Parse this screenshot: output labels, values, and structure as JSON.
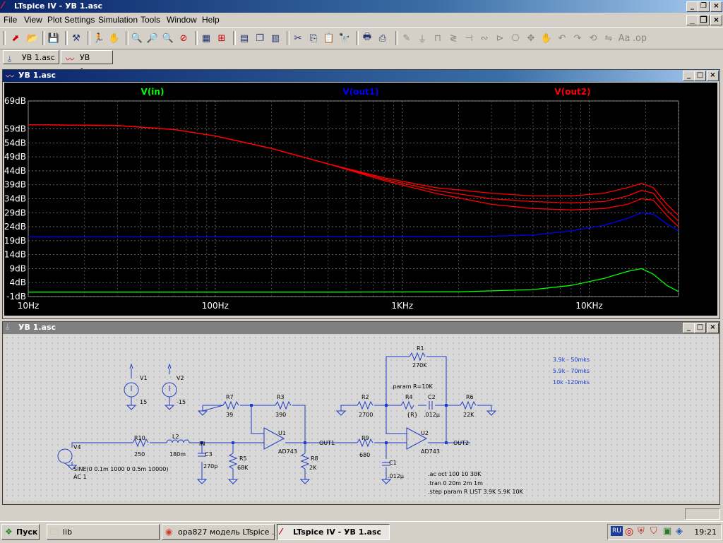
{
  "window": {
    "title": "LTspice IV - УВ 1.asc"
  },
  "menu": [
    "File",
    "View",
    "Plot Settings",
    "Simulation",
    "Tools",
    "Window",
    "Help"
  ],
  "tabs": [
    {
      "label": "УВ 1.asc",
      "icon": "schematic-icon"
    },
    {
      "label": "УВ 1.asc",
      "icon": "waveform-icon"
    }
  ],
  "plot_window": {
    "title": "УВ 1.asc"
  },
  "schematic_window": {
    "title": "УВ 1.asc"
  },
  "chart_data": {
    "type": "line",
    "x_scale": "log",
    "xlim": [
      10,
      30000
    ],
    "ylim": [
      -1,
      69
    ],
    "x_ticks": [
      {
        "v": 10,
        "label": "10Hz"
      },
      {
        "v": 100,
        "label": "100Hz"
      },
      {
        "v": 1000,
        "label": "1KHz"
      },
      {
        "v": 10000,
        "label": "10KHz"
      }
    ],
    "y_ticks": [
      {
        "v": 69,
        "label": "69dB"
      },
      {
        "v": 59,
        "label": "59dB"
      },
      {
        "v": 54,
        "label": "54dB"
      },
      {
        "v": 49,
        "label": "49dB"
      },
      {
        "v": 44,
        "label": "44dB"
      },
      {
        "v": 39,
        "label": "39dB"
      },
      {
        "v": 34,
        "label": "34dB"
      },
      {
        "v": 29,
        "label": "29dB"
      },
      {
        "v": 24,
        "label": "24dB"
      },
      {
        "v": 19,
        "label": "19dB"
      },
      {
        "v": 14,
        "label": "14dB"
      },
      {
        "v": 9,
        "label": "9dB"
      },
      {
        "v": 4,
        "label": "4dB"
      },
      {
        "v": -1,
        "label": "-1dB"
      }
    ],
    "grid": true,
    "series": [
      {
        "name": "V(in)",
        "color": "#00ff00",
        "points": [
          [
            10,
            0.6
          ],
          [
            500,
            0.6
          ],
          [
            2000,
            0.7
          ],
          [
            5000,
            1.5
          ],
          [
            8000,
            3
          ],
          [
            12000,
            5.5
          ],
          [
            16000,
            8
          ],
          [
            19000,
            9
          ],
          [
            22000,
            7
          ],
          [
            26000,
            3
          ],
          [
            30000,
            0.8
          ]
        ]
      },
      {
        "name": "V(out1)",
        "color": "#0000ff",
        "points": [
          [
            10,
            20.3
          ],
          [
            1000,
            20.4
          ],
          [
            3000,
            20.6
          ],
          [
            5000,
            21
          ],
          [
            8000,
            22.5
          ],
          [
            12000,
            24.5
          ],
          [
            16000,
            27
          ],
          [
            19000,
            29
          ],
          [
            22000,
            28.5
          ],
          [
            26000,
            25
          ],
          [
            30000,
            22.5
          ]
        ]
      },
      {
        "name": "V(out2)",
        "color": "#ff0000",
        "points": [
          [
            10,
            60.5
          ],
          [
            30,
            60.2
          ],
          [
            60,
            58.8
          ],
          [
            100,
            56.5
          ],
          [
            200,
            52
          ],
          [
            400,
            46.5
          ],
          [
            800,
            41.5
          ],
          [
            1500,
            38
          ],
          [
            3000,
            36
          ],
          [
            5000,
            35
          ],
          [
            8000,
            35
          ],
          [
            12000,
            36
          ],
          [
            16000,
            38
          ],
          [
            19000,
            39.5
          ],
          [
            22000,
            38
          ],
          [
            26000,
            32
          ],
          [
            30000,
            28
          ]
        ]
      },
      {
        "name": "V(out2)",
        "color": "#ff0000",
        "points": [
          [
            10,
            60.5
          ],
          [
            30,
            60.2
          ],
          [
            60,
            58.8
          ],
          [
            100,
            56.5
          ],
          [
            200,
            52
          ],
          [
            400,
            46.5
          ],
          [
            800,
            41
          ],
          [
            1500,
            37
          ],
          [
            3000,
            34
          ],
          [
            5000,
            33
          ],
          [
            8000,
            32.5
          ],
          [
            12000,
            33
          ],
          [
            16000,
            35
          ],
          [
            19000,
            37
          ],
          [
            22000,
            36
          ],
          [
            26000,
            30
          ],
          [
            30000,
            26
          ]
        ]
      },
      {
        "name": "V(out2)",
        "color": "#ff0000",
        "points": [
          [
            10,
            60.5
          ],
          [
            30,
            60.2
          ],
          [
            60,
            58.8
          ],
          [
            100,
            56.5
          ],
          [
            200,
            52
          ],
          [
            400,
            46.5
          ],
          [
            800,
            40.5
          ],
          [
            1500,
            36
          ],
          [
            3000,
            32
          ],
          [
            5000,
            30.5
          ],
          [
            8000,
            30
          ],
          [
            12000,
            30.5
          ],
          [
            16000,
            32
          ],
          [
            19000,
            34
          ],
          [
            22000,
            33.5
          ],
          [
            26000,
            28
          ],
          [
            30000,
            24
          ]
        ]
      }
    ],
    "legend": [
      {
        "label": "V(in)",
        "color": "#00ff00"
      },
      {
        "label": "V(out1)",
        "color": "#0000ff"
      },
      {
        "label": "V(out2)",
        "color": "#ff0000"
      }
    ]
  },
  "schematic": {
    "components": {
      "V1": {
        "name": "V1",
        "value": "15"
      },
      "V2": {
        "name": "V2",
        "value": "-15"
      },
      "V4": {
        "name": "V4",
        "value1": "SINE(0 0.1m 1000 0 0.5m 10000)",
        "value2": "AC 1"
      },
      "R10": {
        "name": "R10",
        "value": "250"
      },
      "L2": {
        "name": "L2",
        "value": "180m"
      },
      "C3": {
        "name": "C3",
        "value": "270p"
      },
      "R5": {
        "name": "R5",
        "value": "68K"
      },
      "R7": {
        "name": "R7",
        "value": "39"
      },
      "R3": {
        "name": "R3",
        "value": "390"
      },
      "U1": {
        "name": "U1",
        "value": "AD743"
      },
      "R8": {
        "name": "R8",
        "value": "2K"
      },
      "R9": {
        "name": "R9",
        "value": "680"
      },
      "C1": {
        "name": "C1",
        "value": ".012µ"
      },
      "R2": {
        "name": "R2",
        "value": "2700"
      },
      "R1": {
        "name": "R1",
        "value": "270K"
      },
      "R4": {
        "name": "R4",
        "value": "{R}"
      },
      "C2": {
        "name": "C2",
        "value": ".012µ"
      },
      "R6": {
        "name": "R6",
        "value": "22K"
      },
      "U2": {
        "name": "U2",
        "value": "AD743"
      }
    },
    "nets": {
      "in": "IN",
      "out1": "OUT1",
      "out2": "OUT2"
    },
    "directives": [
      ".ac oct 100 10 30K",
      ".tran 0 20m 2m 1m",
      ".step param R LIST 3.9K 5.9K 10K"
    ],
    "param": ".param R=10K",
    "notes": [
      "3.9k - 50mks",
      "5.9k - 70mks",
      "10k -120mks"
    ]
  },
  "taskbar": {
    "start": "Пуск",
    "tasks": [
      {
        "label": "lib",
        "icon": "folder-icon"
      },
      {
        "label": "opa827 модель LTspice ...",
        "icon": "chrome-icon"
      },
      {
        "label": "LTspice IV - УВ 1.asc",
        "icon": "ltspice-icon"
      }
    ],
    "lang": "RU",
    "clock": "19:21"
  }
}
